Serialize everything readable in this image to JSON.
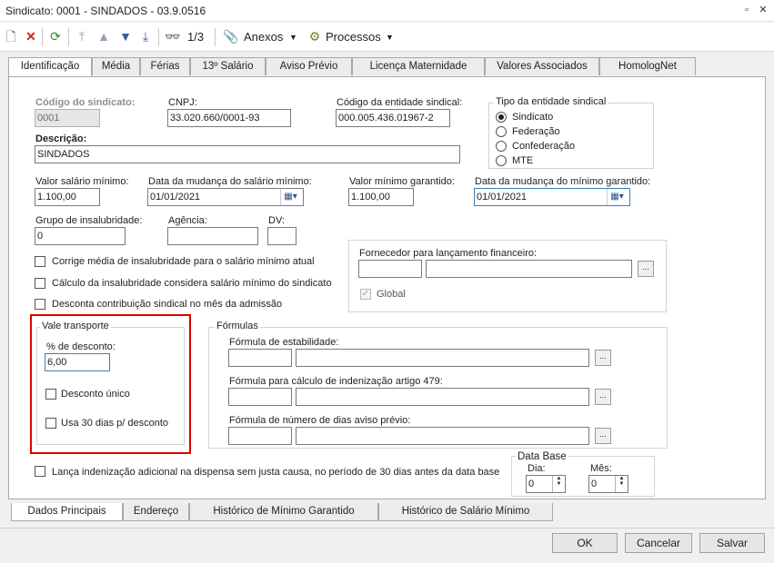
{
  "window": {
    "title": "Sindicato: 0001 - SINDADOS - 03.9.0516"
  },
  "toolbar": {
    "record_counter": "1/3",
    "anexos_label": "Anexos",
    "processos_label": "Processos"
  },
  "tabs": [
    "Identificação",
    "Média",
    "Férias",
    "13º Salário",
    "Aviso Prévio",
    "Licença Maternidade",
    "Valores Associados",
    "HomologNet"
  ],
  "form": {
    "codigo_label": "Código do sindicato:",
    "codigo_value": "0001",
    "cnpj_label": "CNPJ:",
    "cnpj_value": "33.020.660/0001-93",
    "codigo_entidade_label": "Código da entidade sindical:",
    "codigo_entidade_value": "000.005.436.01967-2",
    "descricao_label": "Descrição:",
    "descricao_value": "SINDADOS",
    "tipo_entidade_title": "Tipo da entidade sindical",
    "tipo_options": [
      "Sindicato",
      "Federação",
      "Confederação",
      "MTE"
    ],
    "tipo_selected": "Sindicato",
    "valor_salario_label": "Valor salário mínimo:",
    "valor_salario_value": "1.100,00",
    "data_mudanca_salario_label": "Data da mudança do salário mínimo:",
    "data_mudanca_salario_value": "01/01/2021",
    "valor_minimo_label": "Valor mínimo garantido:",
    "valor_minimo_value": "1.100,00",
    "data_mudanca_minimo_label": "Data da mudança do mínimo garantido:",
    "data_mudanca_minimo_value": "01/01/2021",
    "grupo_label": "Grupo de insalubridade:",
    "grupo_value": "0",
    "agencia_label": "Agência:",
    "agencia_value": "",
    "dv_label": "DV:",
    "dv_value": "",
    "check_corrige": "Corrige média de insalubridade para o salário mínimo atual",
    "check_calculo": "Cálculo da insalubridade considera salário mínimo do sindicato",
    "check_desconta": "Desconta contribuição sindical no mês da admissão",
    "fornecedor_label": "Fornecedor para lançamento financeiro:",
    "global_label": "Global",
    "vale_title": "Vale transporte",
    "percent_label": "% de desconto:",
    "percent_value": "6,00",
    "desconto_unico_label": "Desconto único",
    "usa30_label": "Usa 30 dias p/ desconto",
    "formulas_title": "Fórmulas",
    "formula_estabilidade_label": "Fórmula de estabilidade:",
    "formula_indenizacao_label": "Fórmula para cálculo de indenização artigo 479:",
    "formula_dias_label": "Fórmula de número de dias aviso prévio:",
    "ellipsis": "...",
    "lanca_label": "Lança indenização adicional na dispensa sem justa causa, no período de 30 dias antes da data base",
    "data_base_title": "Data Base",
    "dia_label": "Dia:",
    "dia_value": "0",
    "mes_label": "Mês:",
    "mes_value": "0"
  },
  "bottom_tabs": [
    "Dados Principais",
    "Endereço",
    "Histórico de Mínimo Garantido",
    "Histórico de Salário Mínimo"
  ],
  "buttons": {
    "ok": "OK",
    "cancel": "Cancelar",
    "save": "Salvar"
  },
  "colors": {
    "highlight_box": "#e00000",
    "accent": "#3c7fb1"
  }
}
